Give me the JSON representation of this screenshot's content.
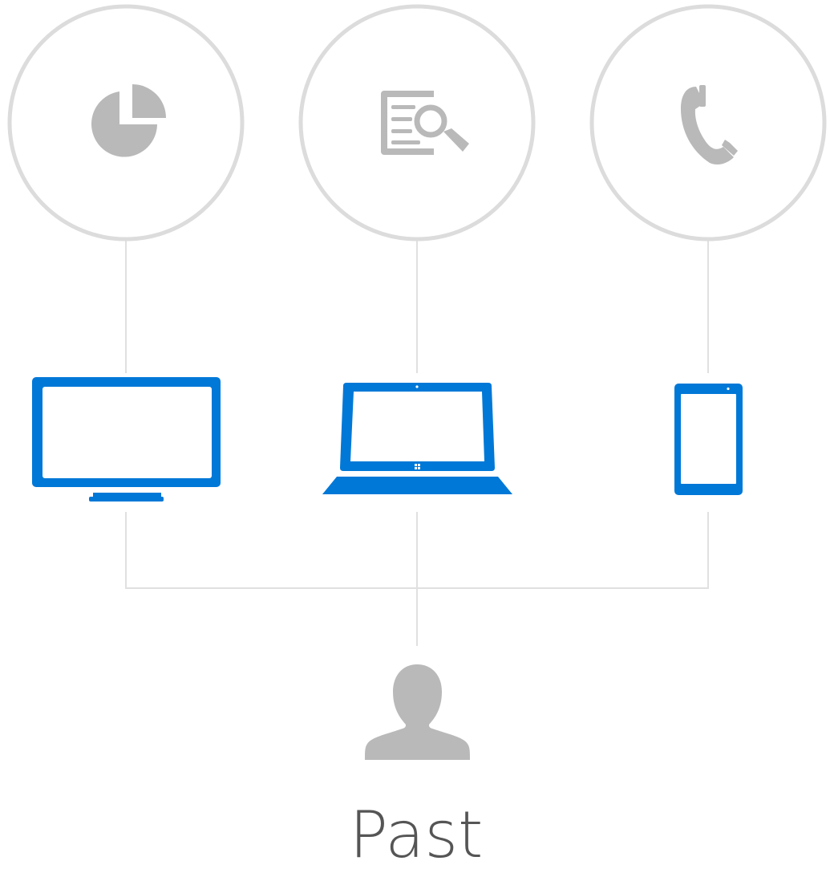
{
  "caption": "Past",
  "colors": {
    "device_blue": "#0078d7",
    "icon_grey": "#b9b9b9",
    "circle_stroke": "#dcdcdc",
    "connector_line": "#e0e0e0",
    "caption_text": "#555555"
  },
  "channels": [
    {
      "icon": "pie-chart-icon",
      "device": "desktop-monitor-icon"
    },
    {
      "icon": "document-search-icon",
      "device": "laptop-icon"
    },
    {
      "icon": "phone-handset-icon",
      "device": "tablet-icon"
    }
  ],
  "person_icon": "person-silhouette-icon"
}
